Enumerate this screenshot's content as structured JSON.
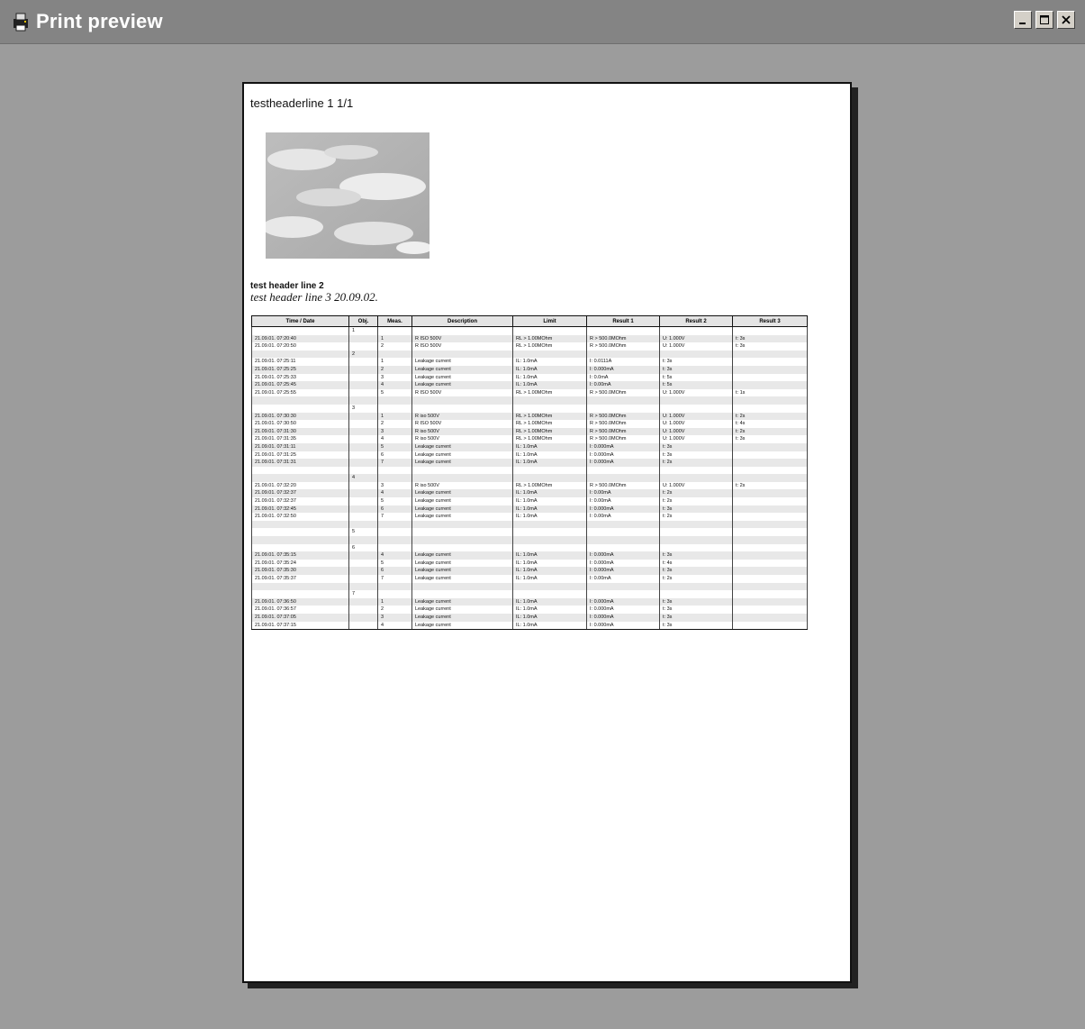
{
  "window": {
    "title": "Print preview",
    "colors": {
      "titlebar": "#848484",
      "workspace": "#9c9c9c",
      "paper": "#ffffff"
    }
  },
  "page": {
    "header_line1": "testheaderline 1   1/1",
    "header_line2": "test header line 2",
    "header_line3": "test header line 3   20.09.02.",
    "columns": [
      "Time / Date",
      "Obj.",
      "Meas.",
      "Description",
      "Limit",
      "Result 1",
      "Result 2",
      "Result 3"
    ],
    "rows": [
      [
        "",
        "1",
        "",
        "",
        "",
        "",
        "",
        ""
      ],
      [
        "21.09.01. 07:20:40",
        "",
        "1",
        "R ISO 500V",
        "RL > 1.00MOhm",
        "R > 500.0MOhm",
        "U: 1.000V",
        "t: 3s"
      ],
      [
        "21.09.01. 07:20:50",
        "",
        "2",
        "R ISO 500V",
        "RL > 1.00MOhm",
        "R > 500.0MOhm",
        "U: 1.000V",
        "t: 3s"
      ],
      [
        "",
        "2",
        "",
        "",
        "",
        "",
        "",
        ""
      ],
      [
        "21.09.01. 07:25:11",
        "",
        "1",
        "Leakage current",
        "IL: 1.0mA",
        "I: 0.0111A",
        "t: 3s",
        ""
      ],
      [
        "21.09.01. 07:25:25",
        "",
        "2",
        "Leakage current",
        "IL: 1.0mA",
        "I: 0.000mA",
        "t: 3s",
        ""
      ],
      [
        "21.09.01. 07:25:33",
        "",
        "3",
        "Leakage current",
        "IL: 1.0mA",
        "I: 0.0mA",
        "t: 5s",
        ""
      ],
      [
        "21.09.01. 07:25:45",
        "",
        "4",
        "Leakage current",
        "IL: 1.0mA",
        "I: 0.00mA",
        "t: 5s",
        ""
      ],
      [
        "21.09.01. 07:25:55",
        "",
        "5",
        "R ISO 500V",
        "RL > 1.00MOhm",
        "R > 500.0MOhm",
        "U: 1.000V",
        "t: 1s"
      ],
      [
        "",
        "",
        "",
        "",
        "",
        "",
        "",
        ""
      ],
      [
        "",
        "3",
        "",
        "",
        "",
        "",
        "",
        ""
      ],
      [
        "21.09.01. 07:30:30",
        "",
        "1",
        "R iso 500V",
        "RL > 1.00MOhm",
        "R > 500.0MOhm",
        "U: 1.000V",
        "t: 2s"
      ],
      [
        "21.09.01. 07:30:50",
        "",
        "2",
        "R ISO 500V",
        "RL > 1.00MOhm",
        "R > 500.0MOhm",
        "U: 1.000V",
        "t: 4s"
      ],
      [
        "21.09.01. 07:31:30",
        "",
        "3",
        "R iso 500V",
        "RL > 1.00MOhm",
        "R > 500.0MOhm",
        "U: 1.000V",
        "t: 2s"
      ],
      [
        "21.09.01. 07:31:35",
        "",
        "4",
        "R iso 500V",
        "RL > 1.00MOhm",
        "R > 500.0MOhm",
        "U: 1.000V",
        "t: 3s"
      ],
      [
        "21.09.01. 07:31:11",
        "",
        "5",
        "Leakage current",
        "IL: 1.0mA",
        "I: 0.000mA",
        "t: 3s",
        ""
      ],
      [
        "21.09.01. 07:31:25",
        "",
        "6",
        "Leakage current",
        "IL: 1.0mA",
        "I: 0.000mA",
        "t: 3s",
        ""
      ],
      [
        "21.09.01. 07:31:31",
        "",
        "7",
        "Leakage current",
        "IL: 1.0mA",
        "I: 0.000mA",
        "t: 2s",
        ""
      ],
      [
        "",
        "",
        "",
        "",
        "",
        "",
        "",
        ""
      ],
      [
        "",
        "4",
        "",
        "",
        "",
        "",
        "",
        ""
      ],
      [
        "21.09.01. 07:32:20",
        "",
        "3",
        "R iso 500V",
        "RL > 1.00MOhm",
        "R > 500.0MOhm",
        "U: 1.000V",
        "t: 2s"
      ],
      [
        "21.09.01. 07:32:37",
        "",
        "4",
        "Leakage current",
        "IL: 1.0mA",
        "I: 0.00mA",
        "t: 2s",
        ""
      ],
      [
        "21.09.01. 07:32:37",
        "",
        "5",
        "Leakage current",
        "IL: 1.0mA",
        "I: 0.00mA",
        "t: 2s",
        ""
      ],
      [
        "21.09.01. 07:32:45",
        "",
        "6",
        "Leakage current",
        "IL: 1.0mA",
        "I: 0.000mA",
        "t: 3s",
        ""
      ],
      [
        "21.09.01. 07:32:50",
        "",
        "7",
        "Leakage current",
        "IL: 1.0mA",
        "I: 0.00mA",
        "t: 2s",
        ""
      ],
      [
        "",
        "",
        "",
        "",
        "",
        "",
        "",
        ""
      ],
      [
        "",
        "5",
        "",
        "",
        "",
        "",
        "",
        ""
      ],
      [
        "",
        "",
        "",
        "",
        "",
        "",
        "",
        ""
      ],
      [
        "",
        "6",
        "",
        "",
        "",
        "",
        "",
        ""
      ],
      [
        "21.09.01. 07:35:15",
        "",
        "4",
        "Leakage current",
        "IL: 1.0mA",
        "I: 0.000mA",
        "t: 3s",
        ""
      ],
      [
        "21.09.01. 07:35:24",
        "",
        "5",
        "Leakage current",
        "IL: 1.0mA",
        "I: 0.000mA",
        "t: 4s",
        ""
      ],
      [
        "21.09.01. 07:35:30",
        "",
        "6",
        "Leakage current",
        "IL: 1.0mA",
        "I: 0.000mA",
        "t: 3s",
        ""
      ],
      [
        "21.09.01. 07:35:37",
        "",
        "7",
        "Leakage current",
        "IL: 1.0mA",
        "I: 0.00mA",
        "t: 2s",
        ""
      ],
      [
        "",
        "",
        "",
        "",
        "",
        "",
        "",
        ""
      ],
      [
        "",
        "7",
        "",
        "",
        "",
        "",
        "",
        ""
      ],
      [
        "21.09.01. 07:36:50",
        "",
        "1",
        "Leakage current",
        "IL: 1.0mA",
        "I: 0.000mA",
        "t: 3s",
        ""
      ],
      [
        "21.09.01. 07:36:57",
        "",
        "2",
        "Leakage current",
        "IL: 1.0mA",
        "I: 0.000mA",
        "t: 3s",
        ""
      ],
      [
        "21.09.01. 07:37:05",
        "",
        "3",
        "Leakage current",
        "IL: 1.0mA",
        "I: 0.000mA",
        "t: 3s",
        ""
      ],
      [
        "21.09.01. 07:37:15",
        "",
        "4",
        "Leakage current",
        "IL: 1.0mA",
        "I: 0.000mA",
        "t: 3s",
        ""
      ]
    ]
  }
}
